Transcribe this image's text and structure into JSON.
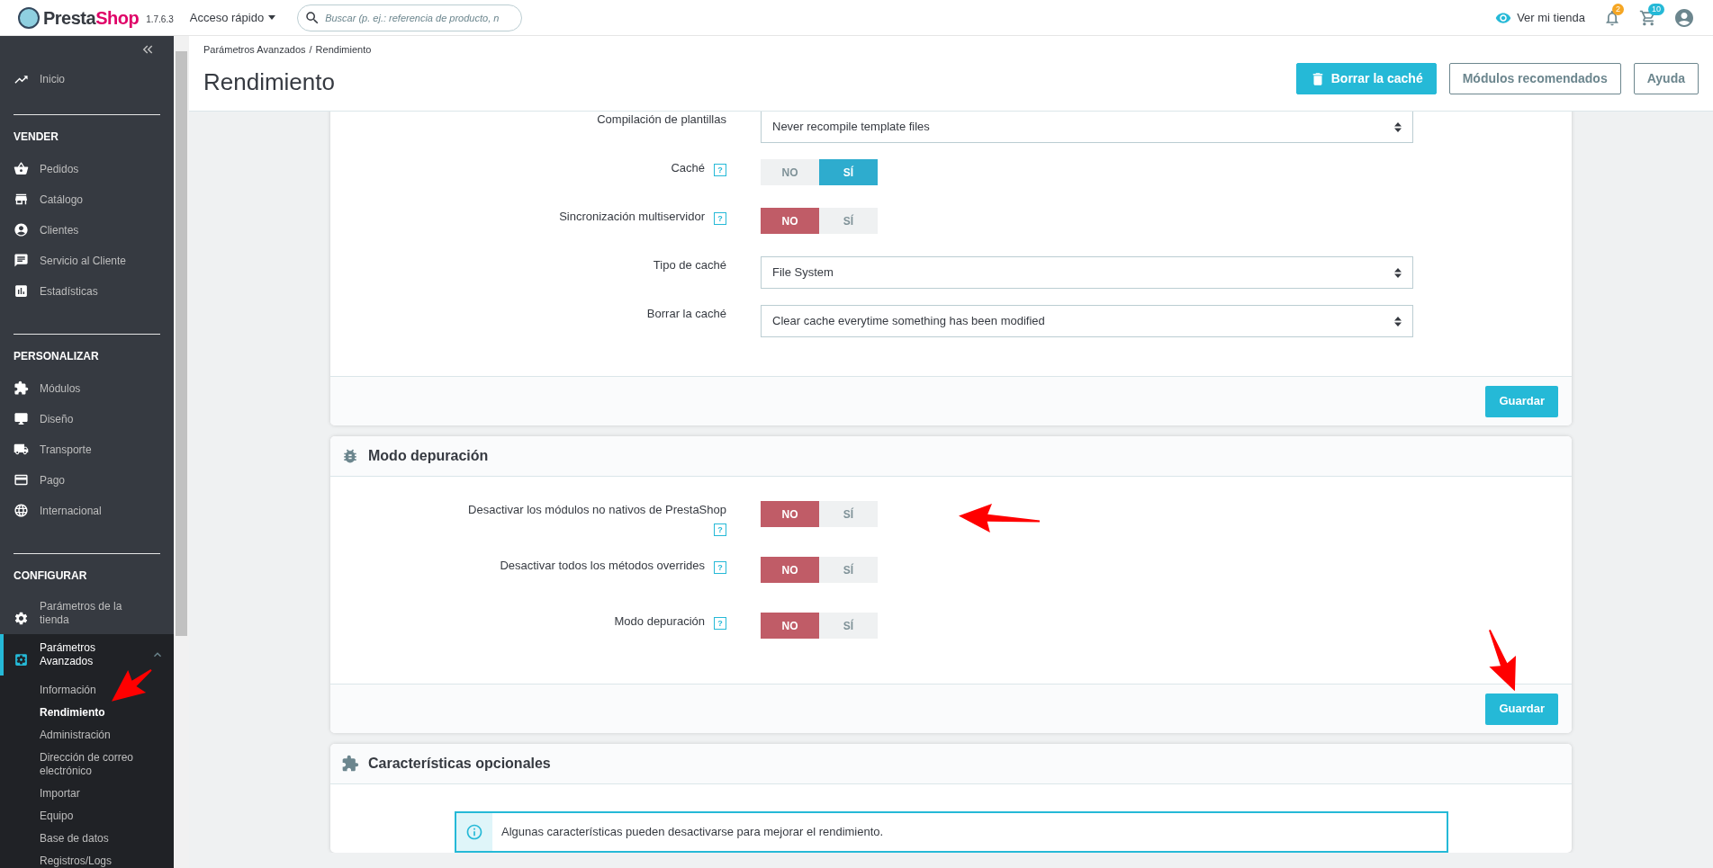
{
  "header": {
    "logo_text": [
      "Presta",
      "Shop"
    ],
    "version": "1.7.6.3",
    "quick_access": "Acceso rápido",
    "search": {
      "placeholder": "Buscar (p. ej.: referencia de producto, n"
    },
    "view_store": "Ver mi tienda",
    "notifications": [
      {
        "kind": "bell",
        "count": "2",
        "color": "#f5a623"
      },
      {
        "kind": "cart",
        "count": "10",
        "color": "#25b9d7"
      }
    ]
  },
  "sidebar": {
    "top_item": {
      "label": "Inicio"
    },
    "sections": [
      {
        "title": "VENDER",
        "items": [
          {
            "label": "Pedidos",
            "selected": false
          },
          {
            "label": "Catálogo",
            "selected": false
          },
          {
            "label": "Clientes",
            "selected": false
          },
          {
            "label": "Servicio al Cliente",
            "selected": false
          },
          {
            "label": "Estadísticas",
            "selected": false
          }
        ]
      },
      {
        "title": "PERSONALIZAR",
        "items": [
          {
            "label": "Módulos",
            "selected": false
          },
          {
            "label": "Diseño",
            "selected": false
          },
          {
            "label": "Transporte",
            "selected": false
          },
          {
            "label": "Pago",
            "selected": false
          },
          {
            "label": "Internacional",
            "selected": false
          }
        ]
      },
      {
        "title": "CONFIGURAR",
        "items": [
          {
            "label": "Parámetros de la tienda",
            "selected": false
          },
          {
            "label": "Parámetros Avanzados",
            "selected": true,
            "expanded": true,
            "children": [
              {
                "label": "Información",
                "selected": false
              },
              {
                "label": "Rendimiento",
                "selected": true
              },
              {
                "label": "Administración",
                "selected": false
              },
              {
                "label": "Dirección de correo electrónico",
                "selected": false
              },
              {
                "label": "Importar",
                "selected": false
              },
              {
                "label": "Equipo",
                "selected": false
              },
              {
                "label": "Base de datos",
                "selected": false
              },
              {
                "label": "Registros/Logs",
                "selected": false
              }
            ]
          }
        ]
      }
    ]
  },
  "page": {
    "breadcrumb": [
      "Parámetros Avanzados",
      "Rendimiento"
    ],
    "breadcrumb_separator": "/",
    "title": "Rendimiento",
    "toolbar": [
      {
        "label": "Borrar la caché",
        "kind": "primary"
      },
      {
        "label": "Módulos recomendados",
        "kind": "outline"
      },
      {
        "label": "Ayuda",
        "kind": "outline"
      }
    ]
  },
  "panels": [
    {
      "rows": [
        {
          "kind": "select",
          "label": "Compilación de plantillas",
          "value": "Never recompile template files"
        },
        {
          "kind": "toggle",
          "label": "Caché",
          "help": "?",
          "options": [
            {
              "label": "NO",
              "selected": false
            },
            {
              "label": "SÍ",
              "selected": true
            }
          ]
        },
        {
          "kind": "toggle",
          "label": "Sincronización multiservidor",
          "help": "?",
          "options": [
            {
              "label": "NO",
              "selected": true
            },
            {
              "label": "SÍ",
              "selected": false
            }
          ]
        },
        {
          "kind": "select",
          "label": "Tipo de caché",
          "value": "File System"
        },
        {
          "kind": "select",
          "label": "Borrar la caché",
          "value": "Clear cache everytime something has been modified"
        }
      ],
      "footer_button": "Guardar"
    },
    {
      "title": "Modo depuración",
      "rows": [
        {
          "kind": "toggle",
          "label": "Desactivar los módulos no nativos de PrestaShop",
          "help": "?",
          "options": [
            {
              "label": "NO",
              "selected": true
            },
            {
              "label": "SÍ",
              "selected": false
            }
          ]
        },
        {
          "kind": "toggle",
          "label": "Desactivar todos los métodos overrides",
          "help": "?",
          "options": [
            {
              "label": "NO",
              "selected": true
            },
            {
              "label": "SÍ",
              "selected": false
            }
          ]
        },
        {
          "kind": "toggle",
          "label": "Modo depuración",
          "help": "?",
          "options": [
            {
              "label": "NO",
              "selected": true
            },
            {
              "label": "SÍ",
              "selected": false
            }
          ]
        }
      ],
      "footer_button": "Guardar"
    },
    {
      "title": "Características opcionales",
      "alert": "Algunas características pueden desactivarse para mejorar el rendimiento."
    }
  ]
}
